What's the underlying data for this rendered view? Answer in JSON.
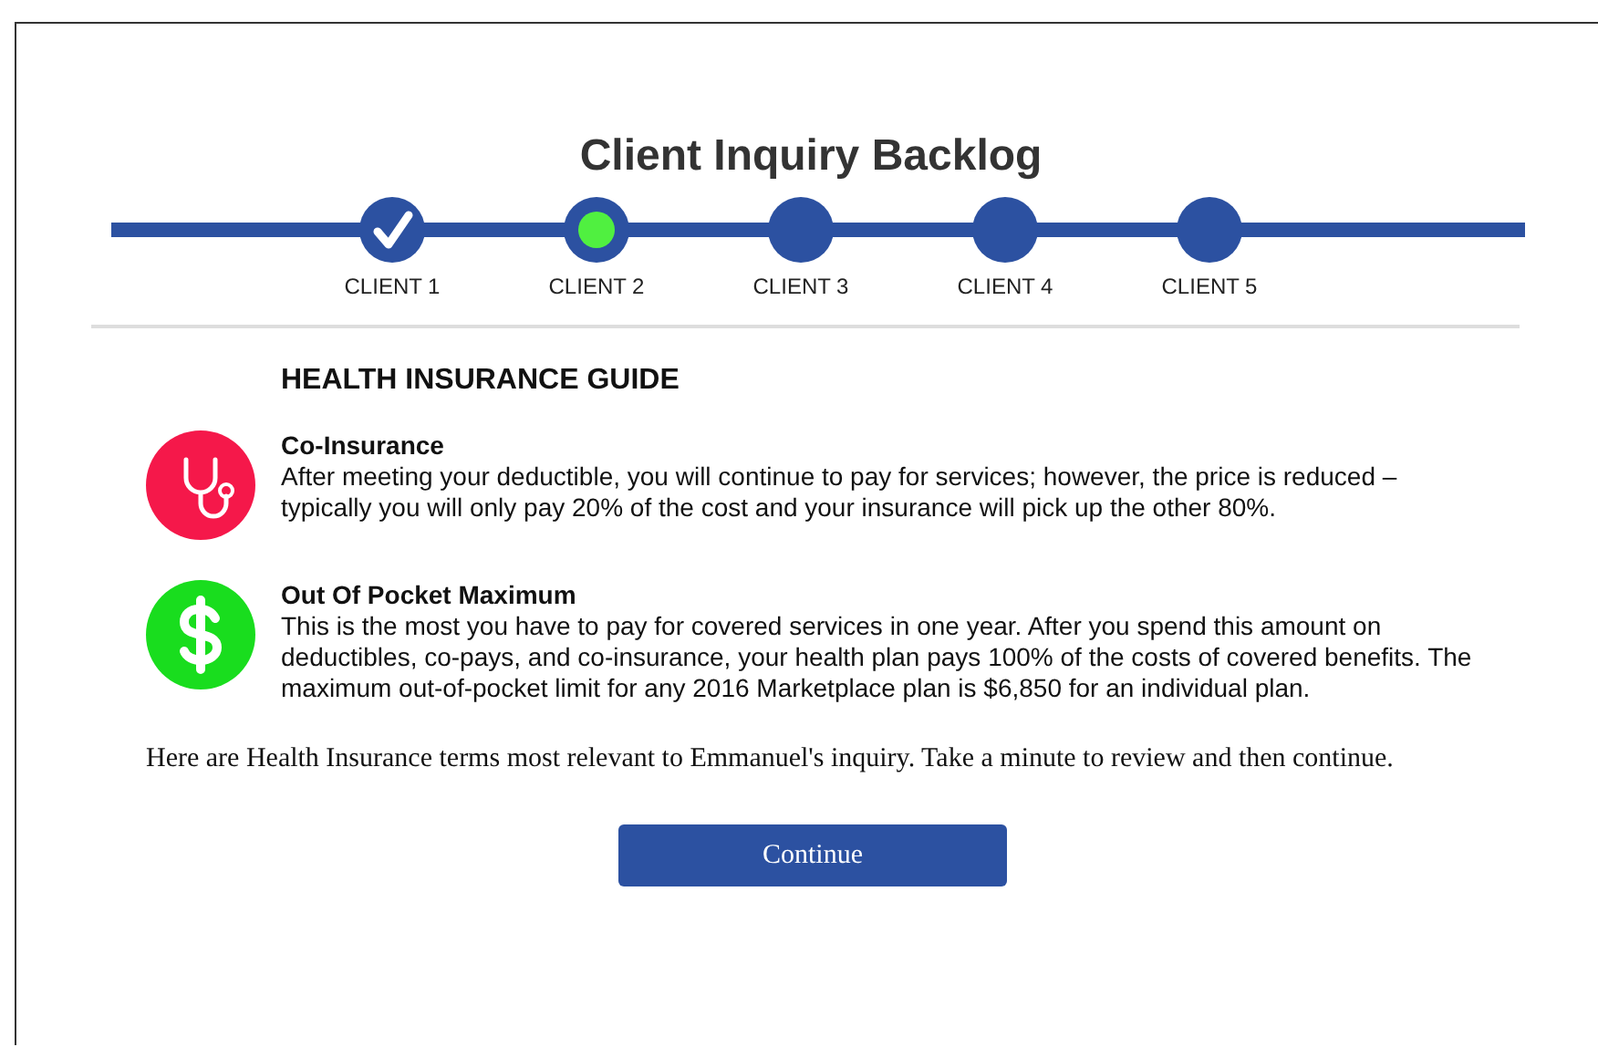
{
  "title": "Client Inquiry Backlog",
  "steps": [
    {
      "label": "CLIENT 1",
      "completed": true,
      "selected": false
    },
    {
      "label": "CLIENT 2",
      "completed": false,
      "selected": true
    },
    {
      "label": "CLIENT 3",
      "completed": false,
      "selected": false
    },
    {
      "label": "CLIENT 4",
      "completed": false,
      "selected": false
    },
    {
      "label": "CLIENT 5",
      "completed": false,
      "selected": false
    }
  ],
  "guide": {
    "heading": "HEALTH INSURANCE GUIDE",
    "terms": [
      {
        "kind": "stethoscope",
        "color": "#f5184a",
        "name": "Co-Insurance",
        "text": "After meeting your deductible, you will continue to pay for services; however, the price is reduced – typically you will only pay 20% of the cost and your insurance will pick up the other 80%."
      },
      {
        "kind": "dollar",
        "color": "#19dd1e",
        "name": "Out Of Pocket Maximum",
        "text": "This is the most you have to pay for covered services in one year. After you spend this amount on deductibles, co-pays, and co-insurance, your health plan pays 100% of the costs of covered benefits. The maximum out-of-pocket limit for any 2016 Marketplace plan is $6,850 for an individual plan."
      }
    ]
  },
  "message": "Here are Health Insurance terms most relevant to Emmanuel's inquiry. Take a minute to review and then continue.",
  "button": "Continue"
}
